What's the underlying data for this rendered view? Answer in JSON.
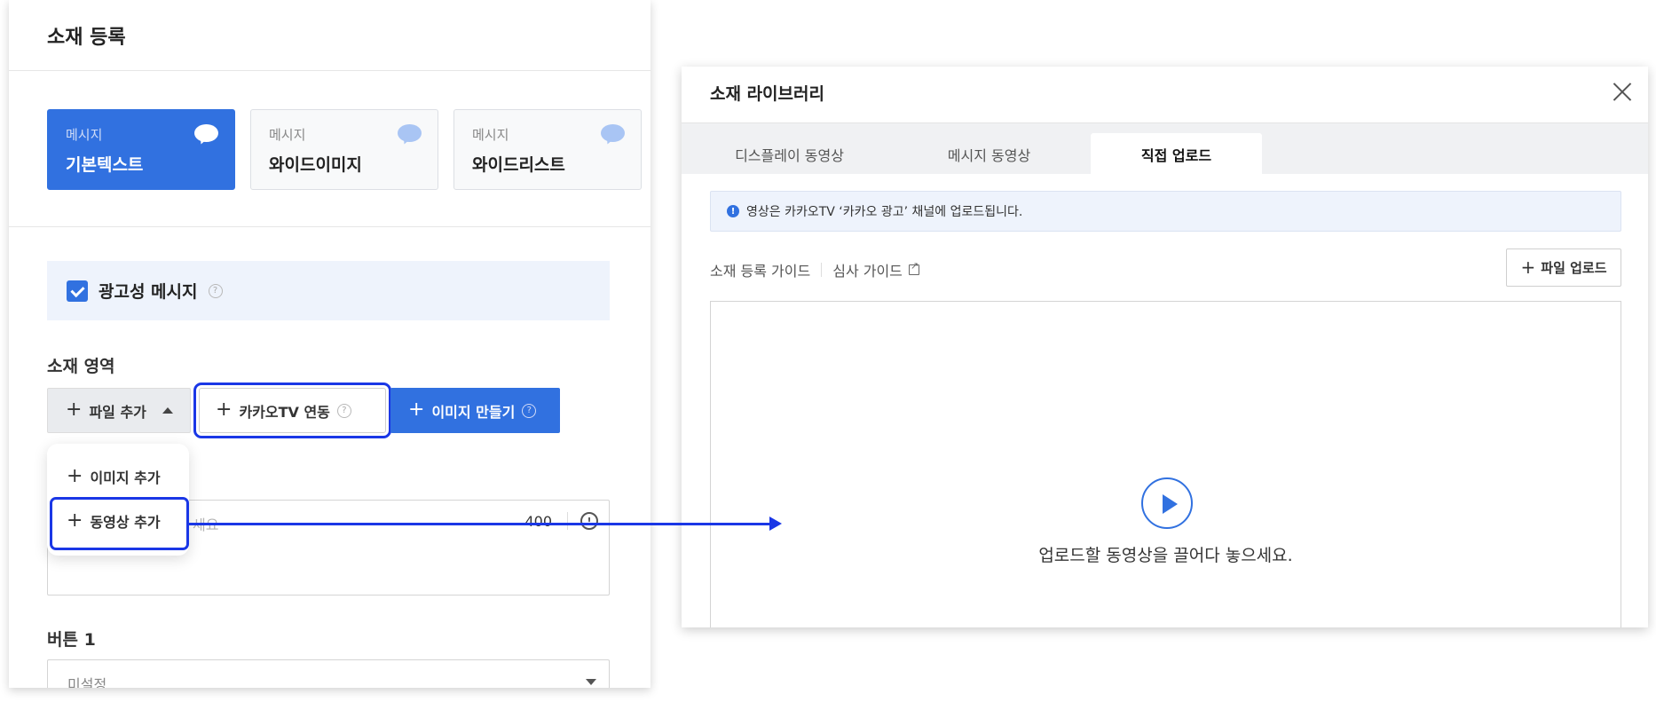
{
  "left_panel": {
    "title": "소재 등록",
    "type_cards": [
      {
        "category": "메시지",
        "name": "기본텍스트"
      },
      {
        "category": "메시지",
        "name": "와이드이미지"
      },
      {
        "category": "메시지",
        "name": "와이드리스트"
      }
    ],
    "ad_message_label": "광고성 메시지",
    "help_glyph": "?",
    "creative_area_label": "소재 영역",
    "buttons": {
      "add_file": "파일 추가",
      "kakao_tv": "카카오TV 연동",
      "make_image": "이미지 만들기"
    },
    "plus_glyph": "+",
    "dropdown": {
      "add_image": "이미지 추가",
      "add_video": "동영상 추가"
    },
    "text_input": {
      "placeholder_partial": "세요",
      "counter": "400",
      "info_glyph": "!"
    },
    "button1_label": "버튼 1",
    "button1_select_value": "미설정",
    "accent_color": "#3171e0",
    "highlight_color": "#1a37e6"
  },
  "library": {
    "title": "소재 라이브러리",
    "tabs": [
      "디스플레이 동영상",
      "메시지 동영상",
      "직접 업로드"
    ],
    "active_tab": "직접 업로드",
    "notice": "영상은 카카오TV ‘카카오 광고’ 채널에 업로드됩니다.",
    "notice_glyph": "!",
    "guide_links": [
      "소재 등록 가이드",
      "심사 가이드"
    ],
    "upload_button": "파일 업로드",
    "drop_text": "업로드할 동영상을 끌어다 놓으세요."
  }
}
